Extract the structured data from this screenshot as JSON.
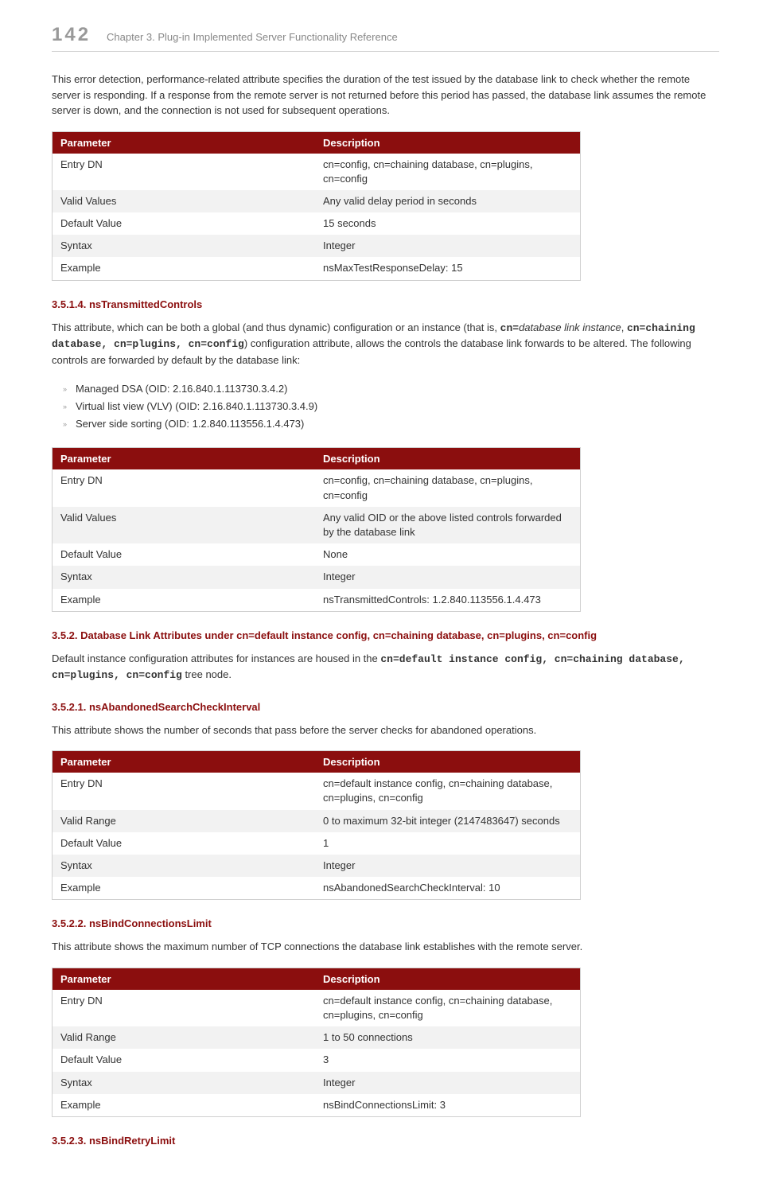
{
  "header": {
    "pageNum": "142",
    "chapter": "Chapter 3. Plug-in Implemented Server Functionality Reference"
  },
  "intro": {
    "paragraph": "This error detection, performance-related attribute specifies the duration of the test issued by the database link to check whether the remote server is responding. If a response from the remote server is not returned before this period has passed, the database link assumes the remote server is down, and the connection is not used for subsequent operations."
  },
  "tableHeaders": {
    "parameter": "Parameter",
    "description": "Description"
  },
  "table1": {
    "rows": [
      {
        "p": "Entry DN",
        "d": "cn=config, cn=chaining database, cn=plugins, cn=config"
      },
      {
        "p": "Valid Values",
        "d": "Any valid delay period in seconds"
      },
      {
        "p": "Default Value",
        "d": "15 seconds"
      },
      {
        "p": "Syntax",
        "d": "Integer"
      },
      {
        "p": "Example",
        "d": "nsMaxTestResponseDelay: 15"
      }
    ]
  },
  "section1": {
    "heading": "3.5.1.4. nsTransmittedControls",
    "para": {
      "t1": "This attribute, which can be both a global (and thus dynamic) configuration or an instance (that is, ",
      "cn": "cn=",
      "dbli": "database link instance",
      "comma": ", ",
      "configStr": "cn=chaining database, cn=plugins, cn=config",
      "t2": ") configuration attribute, allows the controls the database link forwards to be altered. The following controls are forwarded by default by the database link:"
    },
    "list": [
      "Managed DSA (OID: 2.16.840.1.113730.3.4.2)",
      "Virtual list view (VLV) (OID: 2.16.840.1.113730.3.4.9)",
      "Server side sorting (OID: 1.2.840.113556.1.4.473)"
    ]
  },
  "table2": {
    "rows": [
      {
        "p": "Entry DN",
        "d": "cn=config, cn=chaining database, cn=plugins, cn=config"
      },
      {
        "p": "Valid Values",
        "d": "Any valid OID or the above listed controls forwarded by the database link"
      },
      {
        "p": "Default Value",
        "d": "None"
      },
      {
        "p": "Syntax",
        "d": "Integer"
      },
      {
        "p": "Example",
        "d": "nsTransmittedControls: 1.2.840.113556.1.4.473"
      }
    ]
  },
  "section2": {
    "heading": "3.5.2. Database Link Attributes under cn=default instance config, cn=chaining database, cn=plugins, cn=config",
    "para": {
      "t1": "Default instance configuration attributes for instances are housed in the ",
      "configStr": "cn=default instance config, cn=chaining database, cn=plugins, cn=config",
      "t2": " tree node."
    }
  },
  "section3521": {
    "heading": "3.5.2.1. nsAbandonedSearchCheckInterval",
    "para": "This attribute shows the number of seconds that pass before the server checks for abandoned operations."
  },
  "table3": {
    "rows": [
      {
        "p": "Entry DN",
        "d": "cn=default instance config, cn=chaining database, cn=plugins, cn=config"
      },
      {
        "p": "Valid Range",
        "d": "0 to maximum 32-bit integer (2147483647) seconds"
      },
      {
        "p": "Default Value",
        "d": "1"
      },
      {
        "p": "Syntax",
        "d": "Integer"
      },
      {
        "p": "Example",
        "d": "nsAbandonedSearchCheckInterval: 10"
      }
    ]
  },
  "section3522": {
    "heading": "3.5.2.2. nsBindConnectionsLimit",
    "para": "This attribute shows the maximum number of TCP connections the database link establishes with the remote server."
  },
  "table4": {
    "rows": [
      {
        "p": "Entry DN",
        "d": "cn=default instance config, cn=chaining database, cn=plugins, cn=config"
      },
      {
        "p": "Valid Range",
        "d": "1 to 50 connections"
      },
      {
        "p": "Default Value",
        "d": "3"
      },
      {
        "p": "Syntax",
        "d": "Integer"
      },
      {
        "p": "Example",
        "d": "nsBindConnectionsLimit: 3"
      }
    ]
  },
  "section3523": {
    "heading": "3.5.2.3. nsBindRetryLimit"
  }
}
